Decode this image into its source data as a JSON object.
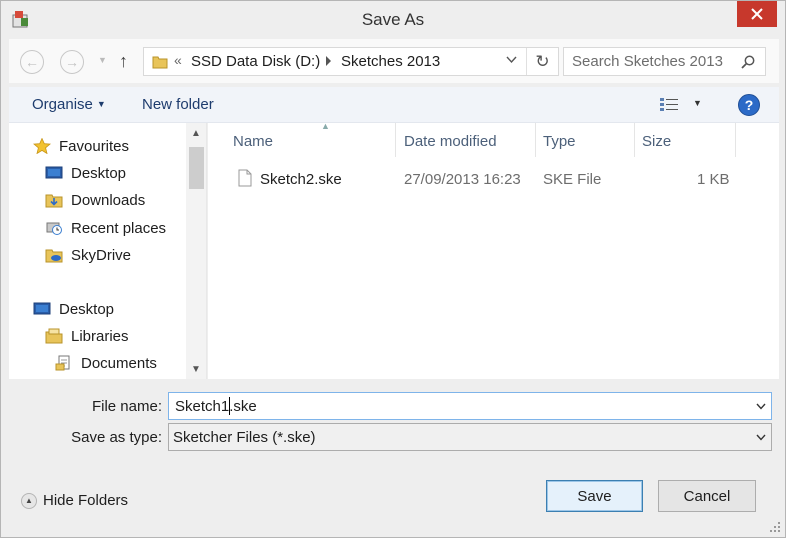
{
  "window": {
    "title": "Save As",
    "close_symbol": "✕"
  },
  "nav": {
    "back_symbol": "←",
    "forward_symbol": "→",
    "up_symbol": "↑",
    "address": {
      "overflow_symbol": "«",
      "segments": [
        "SSD Data Disk (D:)",
        "Sketches 2013"
      ]
    },
    "refresh_symbol": "↻",
    "search_placeholder": "Search Sketches 2013"
  },
  "toolbar": {
    "organise_label": "Organise",
    "new_folder_label": "New folder",
    "help_symbol": "?"
  },
  "tree": {
    "items": [
      {
        "label": "Favourites",
        "icon": "star-icon"
      },
      {
        "label": "Desktop",
        "icon": "desktop-icon"
      },
      {
        "label": "Downloads",
        "icon": "downloads-folder-icon"
      },
      {
        "label": "Recent places",
        "icon": "recent-places-icon"
      },
      {
        "label": "SkyDrive",
        "icon": "skydrive-icon"
      },
      {
        "label": "Desktop",
        "icon": "desktop-icon"
      },
      {
        "label": "Libraries",
        "icon": "libraries-icon"
      },
      {
        "label": "Documents",
        "icon": "documents-icon"
      }
    ]
  },
  "filelist": {
    "columns": [
      "Name",
      "Date modified",
      "Type",
      "Size"
    ],
    "rows": [
      {
        "name": "Sketch2.ske",
        "date": "27/09/2013 16:23",
        "type": "SKE File",
        "size": "1 KB"
      }
    ]
  },
  "form": {
    "file_name_label": "File name:",
    "file_name_value": "Sketch1.ske",
    "save_type_label": "Save as type:",
    "save_type_value": "Sketcher Files (*.ske)"
  },
  "footer": {
    "hide_folders_label": "Hide Folders",
    "save_label": "Save",
    "cancel_label": "Cancel"
  },
  "colors": {
    "close_red": "#c7382c",
    "accent_blue": "#2c6ac7",
    "folder_yellow": "#e8c45a"
  }
}
